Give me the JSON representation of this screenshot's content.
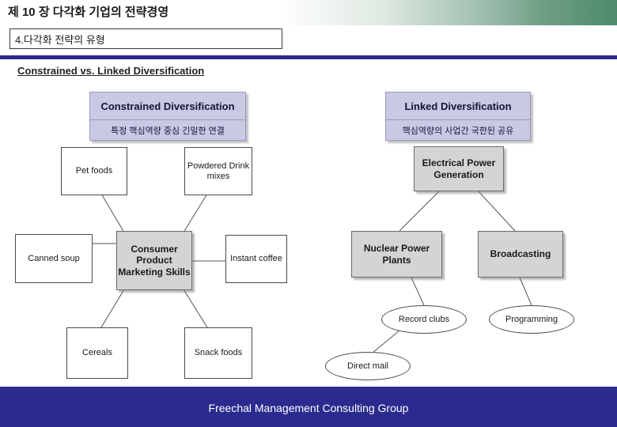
{
  "header": {
    "title": "제 10 장   다각화 기업의 전략경영",
    "subtitle": "4.다각화 전략의 유형"
  },
  "section": {
    "label": "Constrained vs. Linked Diversification"
  },
  "columns": [
    {
      "title": "Constrained Diversification",
      "subtitle": "특정 핵심역량 중심 긴밀한 연결"
    },
    {
      "title": "Linked Diversification",
      "subtitle": "핵심역량의 사업간 국한된 공유"
    }
  ],
  "diagram": {
    "type": "node-link",
    "left_cluster": {
      "center": "Consumer Product Marketing Skills",
      "nodes": [
        "Pet foods",
        "Powdered Drink mixes",
        "Canned soup",
        "Instant coffee",
        "Cereals",
        "Snack foods"
      ]
    },
    "right_cluster": {
      "center": "Electrical Power Generation",
      "nodes": [
        "Nuclear Power Plants",
        "Broadcasting",
        "Record clubs",
        "Programming",
        "Direct mail"
      ]
    }
  },
  "nodes": {
    "pet_foods": "Pet foods",
    "powdered_drink_mixes": "Powdered Drink mixes",
    "canned_soup": "Canned soup",
    "consumer_product_marketing_skills": "Consumer Product Marketing Skills",
    "instant_coffee": "Instant coffee",
    "cereals": "Cereals",
    "snack_foods": "Snack foods",
    "electrical_power_generation": "Electrical Power Generation",
    "nuclear_power_plants": "Nuclear Power Plants",
    "broadcasting": "Broadcasting",
    "record_clubs": "Record clubs",
    "programming": "Programming",
    "direct_mail": "Direct mail"
  },
  "footer": {
    "text": "Freechal Management Consulting Group"
  },
  "colors": {
    "accent": "#2b2b8f",
    "header_box": "#c9c9e4",
    "grey_box": "#d4d4d4"
  }
}
